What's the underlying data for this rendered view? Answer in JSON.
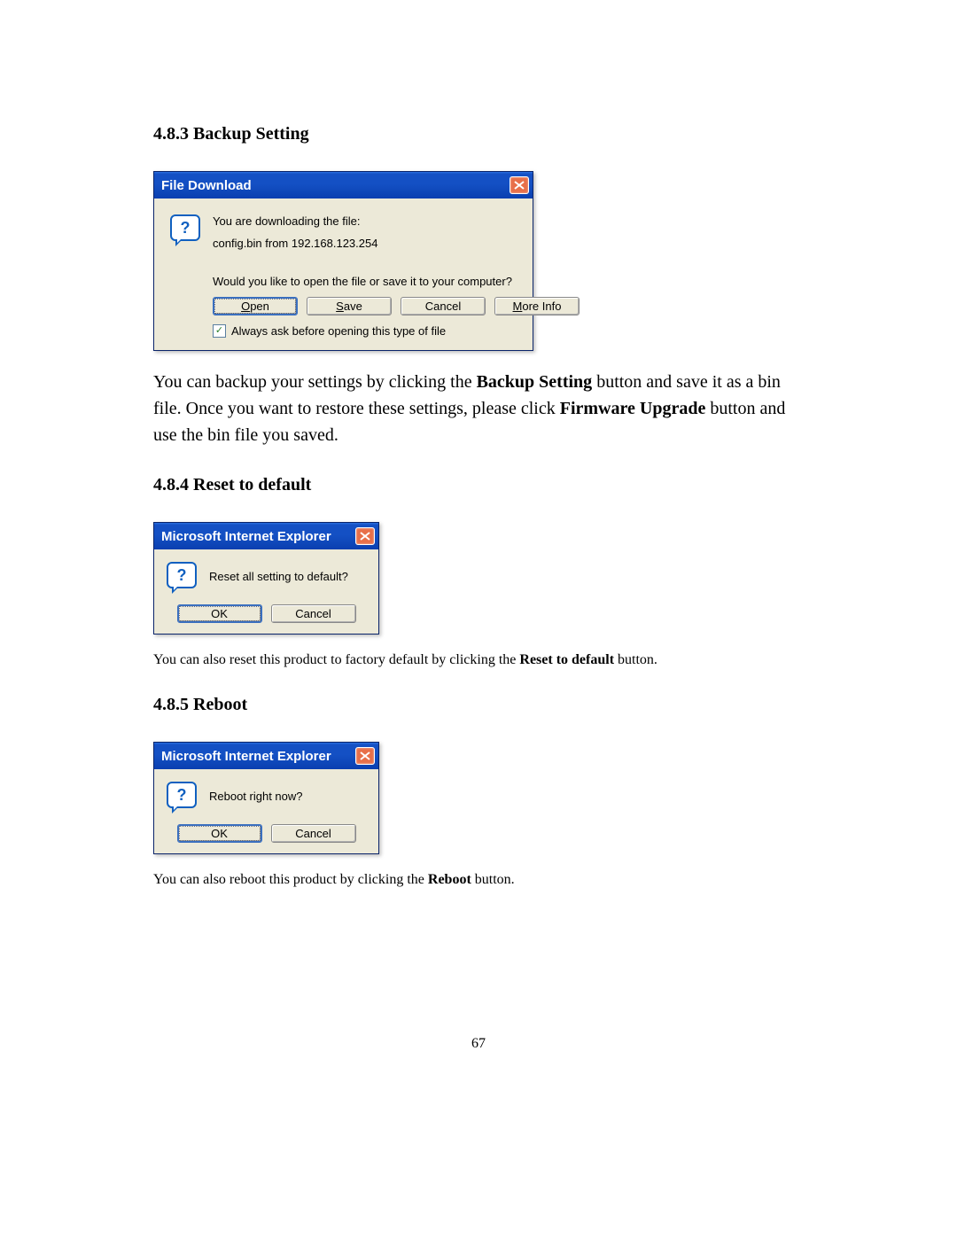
{
  "headings": {
    "backup": "4.8.3 Backup Setting",
    "reset": "4.8.4 Reset to default",
    "reboot": "4.8.5 Reboot"
  },
  "dialogs": {
    "download": {
      "title": "File Download",
      "line1": "You are downloading the file:",
      "line2": "config.bin from 192.168.123.254",
      "prompt": "Would you like to open the file or save it to your computer?",
      "buttons": {
        "open_pre": "O",
        "open_post": "pen",
        "save_pre": "S",
        "save_post": "ave",
        "cancel": "Cancel",
        "more_pre": "M",
        "more_post": "ore Info"
      },
      "checkbox_label_pre": "Al",
      "checkbox_label_mn": "w",
      "checkbox_label_post": "ays ask before opening this type of file",
      "checkbox_checked": "✓"
    },
    "reset": {
      "title": "Microsoft Internet Explorer",
      "message": "Reset all setting to default?",
      "ok": "OK",
      "cancel": "Cancel"
    },
    "reboot": {
      "title": "Microsoft Internet Explorer",
      "message": "Reboot right now?",
      "ok": "OK",
      "cancel": "Cancel"
    }
  },
  "paragraphs": {
    "backup_p1a": "You can backup your settings by clicking the ",
    "backup_p1b": "Backup Setting",
    "backup_p1c": " button and save it as a bin file. Once you want to restore these settings, please click ",
    "backup_p1d": "Firmware Upgrade",
    "backup_p1e": " button and use the bin file you saved.",
    "reset_p1a": "You can also reset this product to factory default by clicking the ",
    "reset_p1b": "Reset to default",
    "reset_p1c": " button.",
    "reboot_p1a": "You can also reboot this product by clicking the ",
    "reboot_p1b": "Reboot",
    "reboot_p1c": " button."
  },
  "page_number": "67"
}
